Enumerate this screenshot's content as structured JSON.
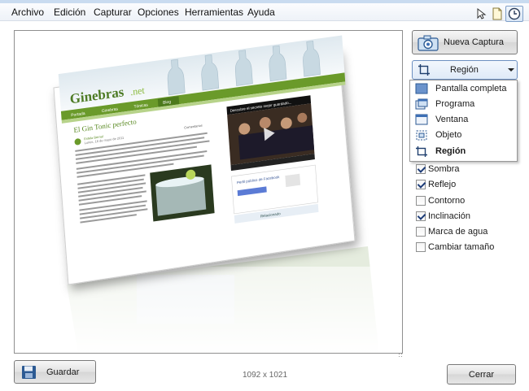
{
  "menubar": {
    "items": [
      "Archivo",
      "Edición",
      "Capturar",
      "Opciones",
      "Herramientas",
      "Ayuda"
    ]
  },
  "toolbar": {
    "icons": [
      "cursor-icon",
      "page-icon",
      "timer-icon"
    ]
  },
  "preview": {
    "screenshot": {
      "logo_text": "Ginebras",
      "logo_suffix": ".net",
      "nav_items": [
        "Portada",
        "Ginebras",
        "Tónicas",
        "Blog"
      ],
      "article_title": "El Gin Tonic perfecto",
      "author_label": "Estela Bernal",
      "date_label": "Lunes, 16 de mayo de 2011",
      "comments_label": "Comentarios",
      "video_title": "Descubre el secreto mejor guardado...",
      "facebook_label": "Perfil público de Facebook",
      "blogroll_label": "Relacionado"
    }
  },
  "buttons": {
    "new_capture": "Nueva Captura",
    "save": "Guardar",
    "close": "Cerrar"
  },
  "region_select": {
    "value": "Región"
  },
  "dropdown": {
    "items": [
      {
        "label": "Pantalla completa",
        "icon": "fullscreen-icon"
      },
      {
        "label": "Programa",
        "icon": "program-icon"
      },
      {
        "label": "Ventana",
        "icon": "window-icon"
      },
      {
        "label": "Objeto",
        "icon": "object-icon"
      },
      {
        "label": "Región",
        "icon": "region-icon",
        "selected": true
      }
    ]
  },
  "options": [
    {
      "label": "Sombra",
      "checked": true
    },
    {
      "label": "Reflejo",
      "checked": true
    },
    {
      "label": "Contorno",
      "checked": false
    },
    {
      "label": "Inclinación",
      "checked": true
    },
    {
      "label": "Marca de agua",
      "checked": false
    },
    {
      "label": "Cambiar tamaño",
      "checked": false
    }
  ],
  "status": {
    "dimensions": "1092 x 1021"
  },
  "colors": {
    "accent": "#3d6fb5",
    "site_green": "#6a9a2a",
    "dropdown_border": "#979797"
  }
}
